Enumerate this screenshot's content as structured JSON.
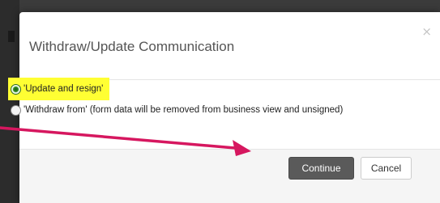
{
  "dialog": {
    "title": "Withdraw/Update Communication",
    "close_icon": "×",
    "options": [
      {
        "label": "'Update and resign'",
        "checked": true,
        "highlighted": true
      },
      {
        "label": "'Withdraw from' (form data will be removed from business view and unsigned)",
        "checked": false,
        "highlighted": false
      }
    ],
    "buttons": {
      "continue_label": "Continue",
      "cancel_label": "Cancel"
    }
  },
  "annotation": {
    "arrow_color": "#d6175f",
    "highlight_color": "#ffff33"
  }
}
